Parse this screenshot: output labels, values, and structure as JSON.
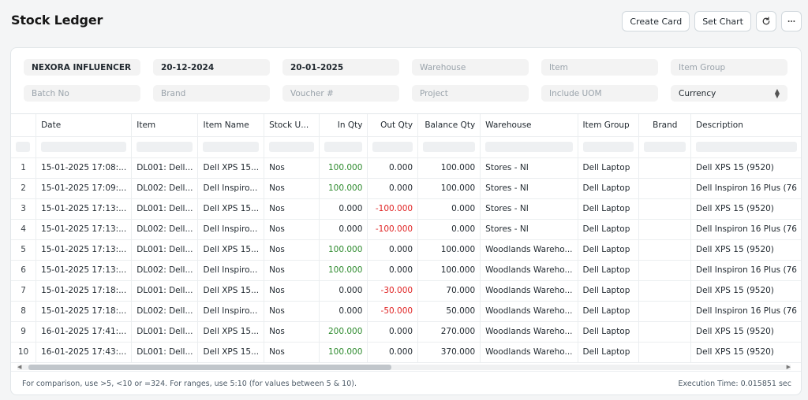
{
  "page": {
    "title": "Stock Ledger"
  },
  "actions": {
    "create_card": "Create Card",
    "set_chart": "Set Chart",
    "refresh_icon": "refresh-icon",
    "more_icon": "more-icon"
  },
  "filters": {
    "row1": [
      {
        "value": "NEXORA INFLUENCER",
        "placeholder": ""
      },
      {
        "value": "20-12-2024",
        "placeholder": ""
      },
      {
        "value": "20-01-2025",
        "placeholder": ""
      },
      {
        "value": "",
        "placeholder": "Warehouse"
      },
      {
        "value": "",
        "placeholder": "Item"
      },
      {
        "value": "",
        "placeholder": "Item Group"
      }
    ],
    "row2": [
      {
        "value": "",
        "placeholder": "Batch No"
      },
      {
        "value": "",
        "placeholder": "Brand"
      },
      {
        "value": "",
        "placeholder": "Voucher #"
      },
      {
        "value": "",
        "placeholder": "Project"
      },
      {
        "value": "",
        "placeholder": "Include UOM"
      },
      {
        "value": "Currency",
        "placeholder": ""
      }
    ]
  },
  "table": {
    "columns": [
      "",
      "Date",
      "Item",
      "Item Name",
      "Stock U...",
      "In Qty",
      "Out Qty",
      "Balance Qty",
      "Warehouse",
      "Item Group",
      "Brand",
      "Description"
    ],
    "rows": [
      [
        "1",
        "15-01-2025 17:08:...",
        "DL001: Dell...",
        "Dell XPS 15...",
        "Nos",
        "100.000",
        "0.000",
        "100.000",
        "Stores - NI",
        "Dell Laptop",
        "",
        "Dell XPS 15 (9520)"
      ],
      [
        "2",
        "15-01-2025 17:09:...",
        "DL002: Dell...",
        "Dell Inspiro...",
        "Nos",
        "100.000",
        "0.000",
        "100.000",
        "Stores - NI",
        "Dell Laptop",
        "",
        "Dell Inspiron 16 Plus (76"
      ],
      [
        "3",
        "15-01-2025 17:13:...",
        "DL001: Dell...",
        "Dell XPS 15...",
        "Nos",
        "0.000",
        "-100.000",
        "0.000",
        "Stores - NI",
        "Dell Laptop",
        "",
        "Dell XPS 15 (9520)"
      ],
      [
        "4",
        "15-01-2025 17:13:...",
        "DL002: Dell...",
        "Dell Inspiro...",
        "Nos",
        "0.000",
        "-100.000",
        "0.000",
        "Stores - NI",
        "Dell Laptop",
        "",
        "Dell Inspiron 16 Plus (76"
      ],
      [
        "5",
        "15-01-2025 17:13:...",
        "DL001: Dell...",
        "Dell XPS 15...",
        "Nos",
        "100.000",
        "0.000",
        "100.000",
        "Woodlands Wareho...",
        "Dell Laptop",
        "",
        "Dell XPS 15 (9520)"
      ],
      [
        "6",
        "15-01-2025 17:13:...",
        "DL002: Dell...",
        "Dell Inspiro...",
        "Nos",
        "100.000",
        "0.000",
        "100.000",
        "Woodlands Wareho...",
        "Dell Laptop",
        "",
        "Dell Inspiron 16 Plus (76"
      ],
      [
        "7",
        "15-01-2025 17:18:...",
        "DL001: Dell...",
        "Dell XPS 15...",
        "Nos",
        "0.000",
        "-30.000",
        "70.000",
        "Woodlands Wareho...",
        "Dell Laptop",
        "",
        "Dell XPS 15 (9520)"
      ],
      [
        "8",
        "15-01-2025 17:18:...",
        "DL002: Dell...",
        "Dell Inspiro...",
        "Nos",
        "0.000",
        "-50.000",
        "50.000",
        "Woodlands Wareho...",
        "Dell Laptop",
        "",
        "Dell Inspiron 16 Plus (76"
      ],
      [
        "9",
        "16-01-2025 17:41:...",
        "DL001: Dell...",
        "Dell XPS 15...",
        "Nos",
        "200.000",
        "0.000",
        "270.000",
        "Woodlands Wareho...",
        "Dell Laptop",
        "",
        "Dell XPS 15 (9520)"
      ],
      [
        "10",
        "16-01-2025 17:43:...",
        "DL001: Dell...",
        "Dell XPS 15...",
        "Nos",
        "100.000",
        "0.000",
        "370.000",
        "Woodlands Wareho...",
        "Dell Laptop",
        "",
        "Dell XPS 15 (9520)"
      ]
    ]
  },
  "footer": {
    "hint": "For comparison, use >5, <10 or =324. For ranges, use 5:10 (for values between 5 & 10).",
    "execution_time": "Execution Time: 0.015851 sec"
  },
  "colors": {
    "positive": "#2d8a2d",
    "negative": "#e02424"
  }
}
